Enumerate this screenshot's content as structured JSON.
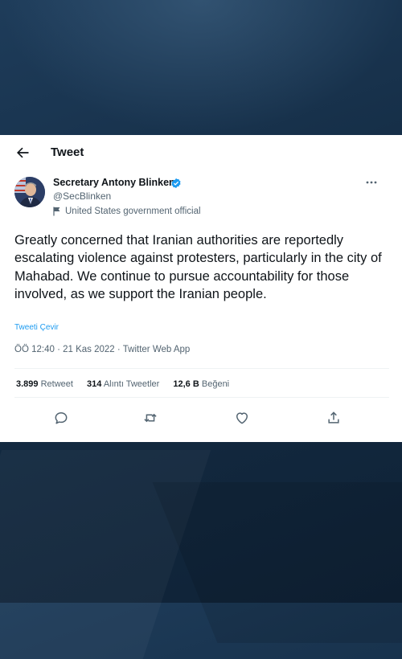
{
  "header": {
    "title": "Tweet"
  },
  "author": {
    "name": "Secretary Antony Blinken",
    "handle": "@SecBlinken",
    "label": "United States government official"
  },
  "tweet": {
    "text": "Greatly concerned that Iranian authorities are reportedly escalating violence against protesters, particularly in the city of Mahabad. We continue to pursue accountability for those involved, as we support the Iranian people.",
    "translate_label": "Tweeti Çevir",
    "time": "ÖÖ 12:40",
    "date": "21 Kas 2022",
    "source": "Twitter Web App",
    "separator": "·"
  },
  "stats": {
    "retweets": {
      "count": "3.899",
      "label": "Retweet"
    },
    "quotes": {
      "count": "314",
      "label": "Alıntı Tweetler"
    },
    "likes": {
      "count": "12,6 B",
      "label": "Beğeni"
    }
  },
  "icons": {
    "back": "arrow-left-icon",
    "verified": "verified-badge-icon",
    "more": "more-dots-icon",
    "flag": "flag-icon",
    "reply": "reply-icon",
    "retweet": "retweet-icon",
    "like": "heart-icon",
    "share": "share-icon"
  },
  "colors": {
    "accent": "#1d9bf0",
    "text": "#0f1419",
    "secondary": "#536471",
    "background": "#142c44"
  }
}
